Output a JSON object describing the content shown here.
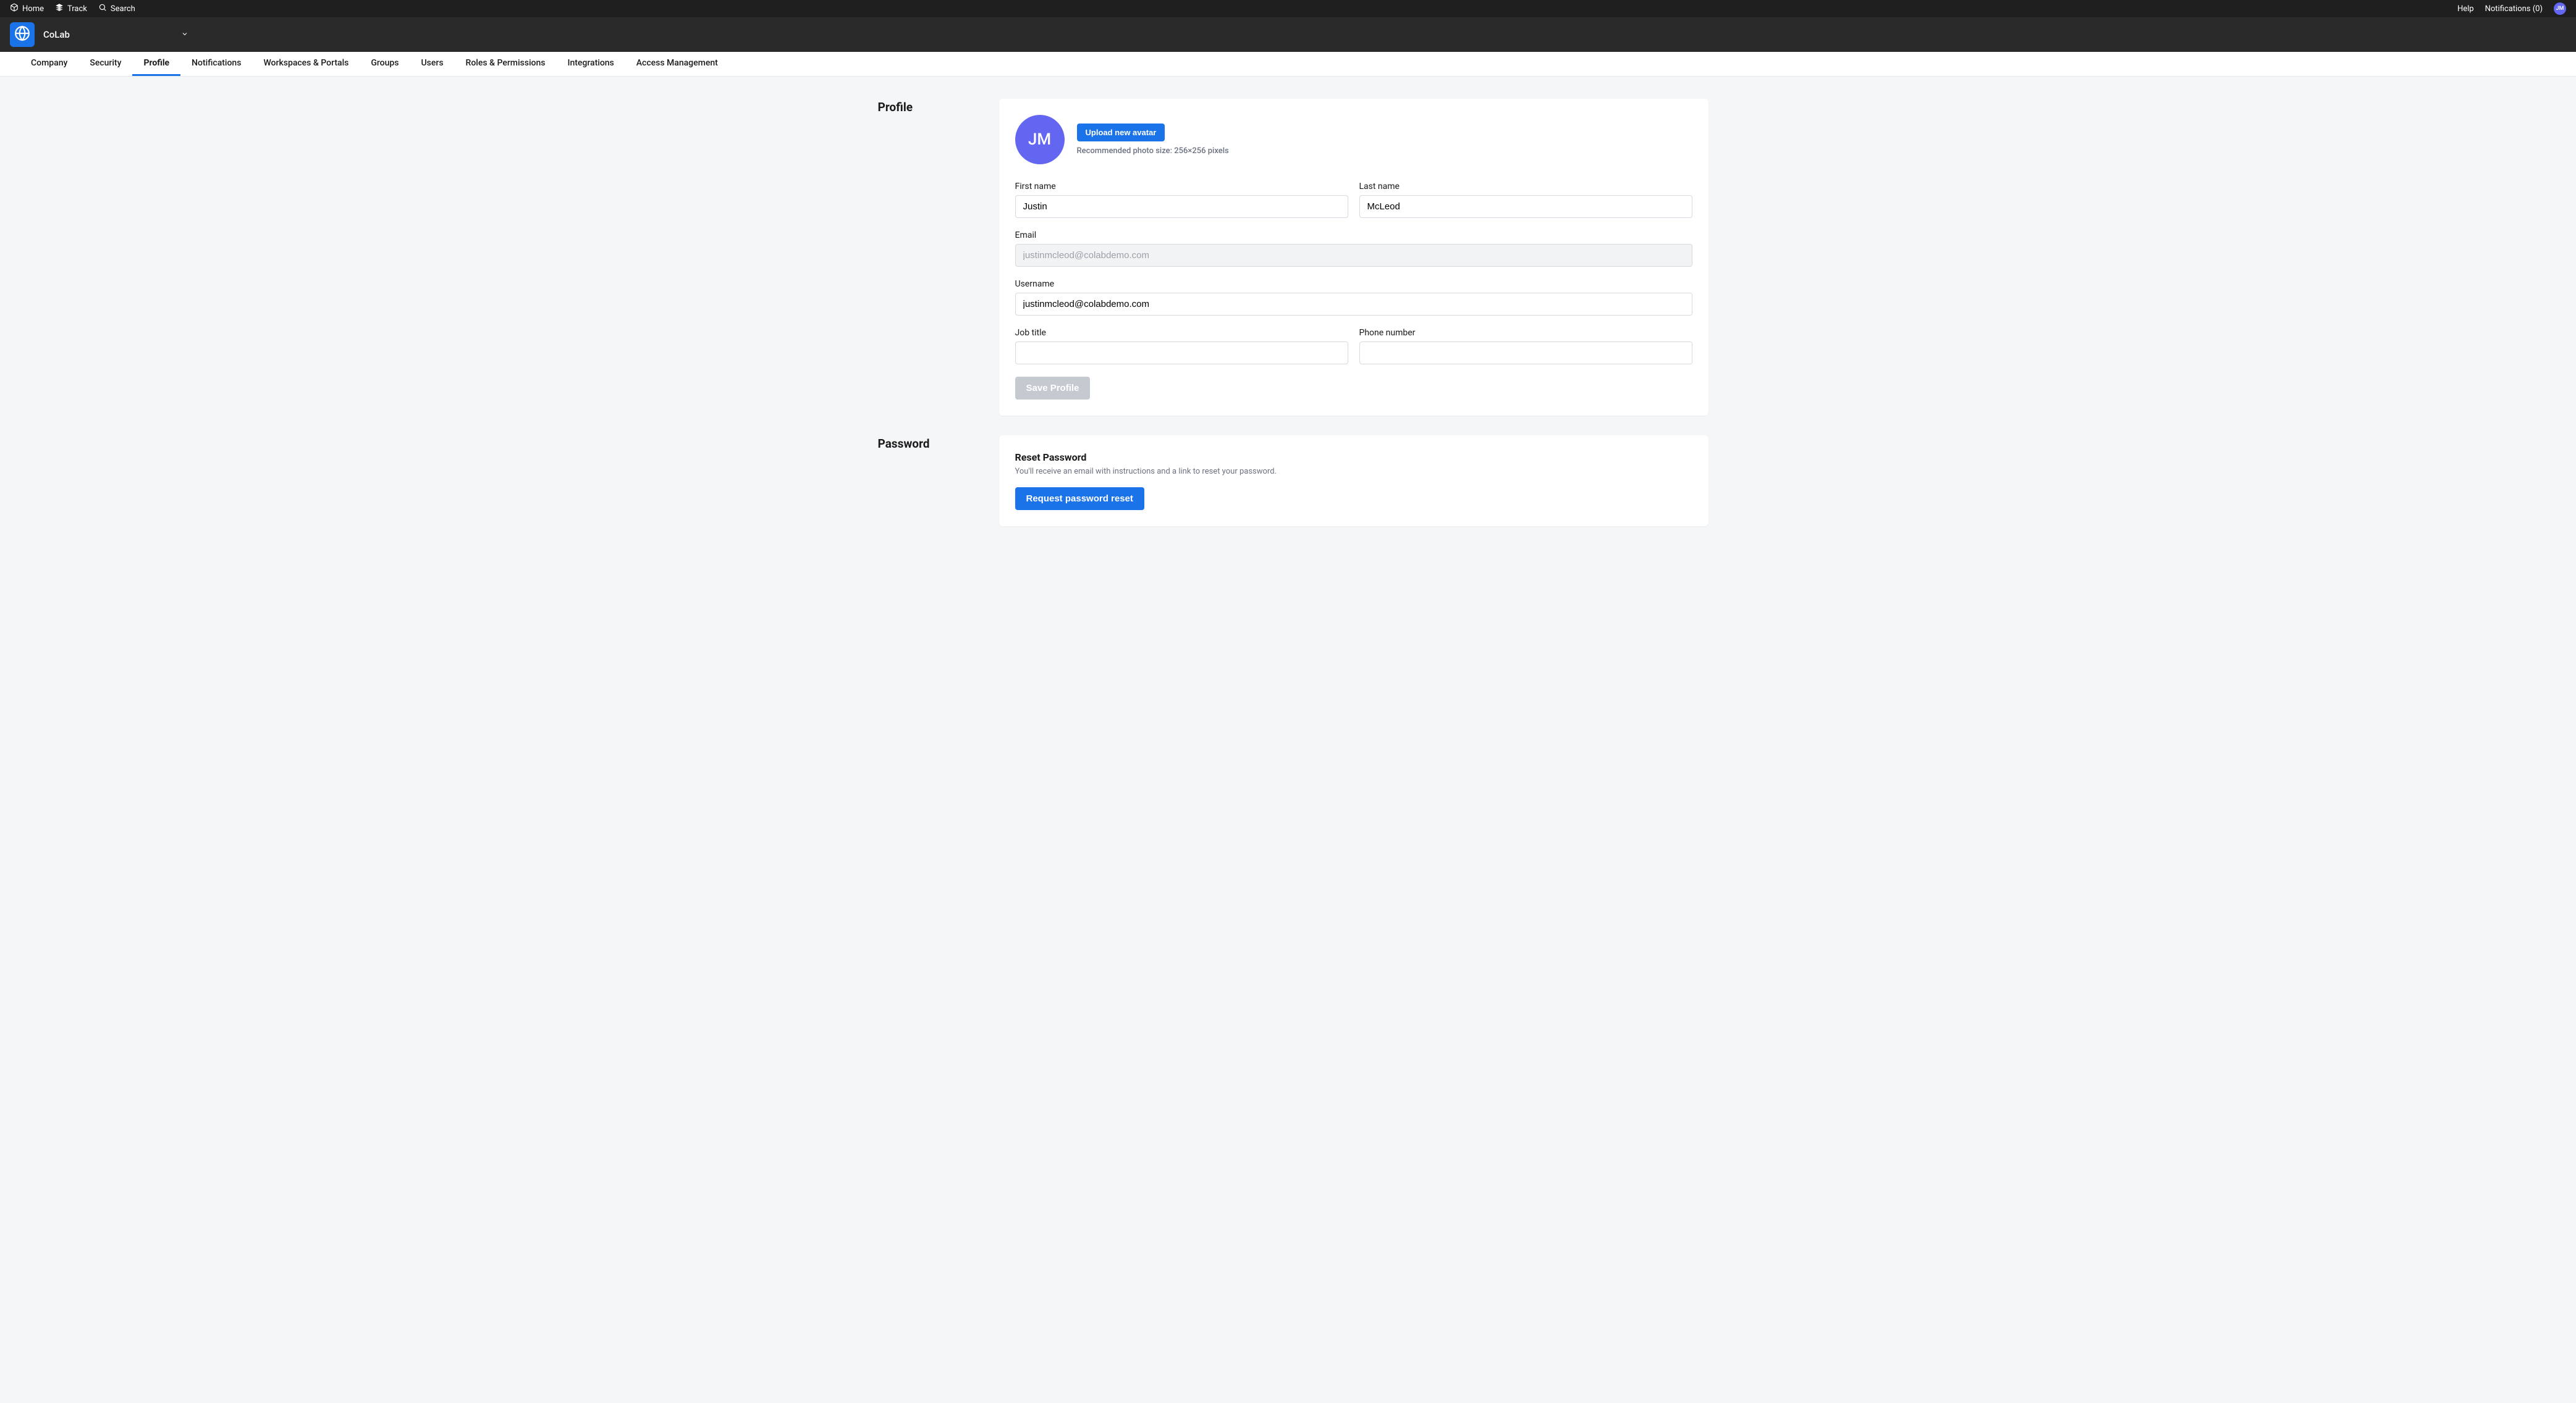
{
  "topbar": {
    "home": "Home",
    "track": "Track",
    "search": "Search",
    "help": "Help",
    "notifications": "Notifications (0)",
    "avatar_initials": "JM"
  },
  "app": {
    "name": "CoLab"
  },
  "tabs": [
    "Company",
    "Security",
    "Profile",
    "Notifications",
    "Workspaces & Portals",
    "Groups",
    "Users",
    "Roles & Permissions",
    "Integrations",
    "Access Management"
  ],
  "active_tab_index": 2,
  "profile_section": {
    "title": "Profile",
    "avatar_initials": "JM",
    "upload_button": "Upload new avatar",
    "upload_hint": "Recommended photo size: 256×256 pixels",
    "labels": {
      "first_name": "First name",
      "last_name": "Last name",
      "email": "Email",
      "username": "Username",
      "job_title": "Job title",
      "phone": "Phone number"
    },
    "values": {
      "first_name": "Justin",
      "last_name": "McLeod",
      "email": "justinmcleod@colabdemo.com",
      "username": "justinmcleod@colabdemo.com",
      "job_title": "",
      "phone": ""
    },
    "save_button": "Save Profile"
  },
  "password_section": {
    "title": "Password",
    "heading": "Reset Password",
    "subtext": "You'll receive an email with instructions and a link to reset your password.",
    "button": "Request password reset"
  }
}
